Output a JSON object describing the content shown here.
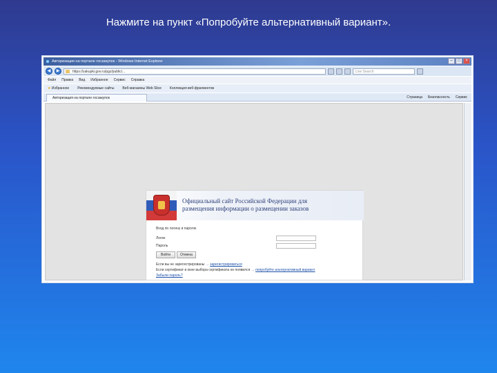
{
  "slide": {
    "instruction": "Нажмите на пункт «Попробуйте альтернативный вариант»."
  },
  "browser": {
    "window_title": "Авторизация на портале госзакупок - Windows Internet Explorer",
    "url": "https://zakupki.gov.ru/pgz/public/...",
    "search_placeholder": "Live Search",
    "menu": [
      "Файл",
      "Правка",
      "Вид",
      "Избранное",
      "Сервис",
      "Справка"
    ],
    "favorites": {
      "label": "Избранное",
      "items": [
        "Рекомендуемые сайты",
        "Веб-магазины Web Slice",
        "Коллекция веб-фрагментов"
      ]
    },
    "tab_title": "Авторизация на портале госзакупок",
    "command_bar": [
      "Страница",
      "Безопасность",
      "Сервис"
    ]
  },
  "page": {
    "banner_line1": "Официальный сайт Российской Федерации для",
    "banner_line2": "размещения информации о размещении заказов",
    "form_header": "Вход по логину и паролю",
    "login_label": "Логин",
    "password_label": "Пароль",
    "login_button": "Войти",
    "cancel_button": "Отмена",
    "register_prefix": "Если вы не зарегистрированы",
    "register_link": "зарегистрироваться",
    "alt_prefix": "Если сертификат в окне выбора сертификата не появился",
    "alt_link": "попробуйте альтернативный вариант",
    "forgot_link": "Забыли пароль?"
  }
}
